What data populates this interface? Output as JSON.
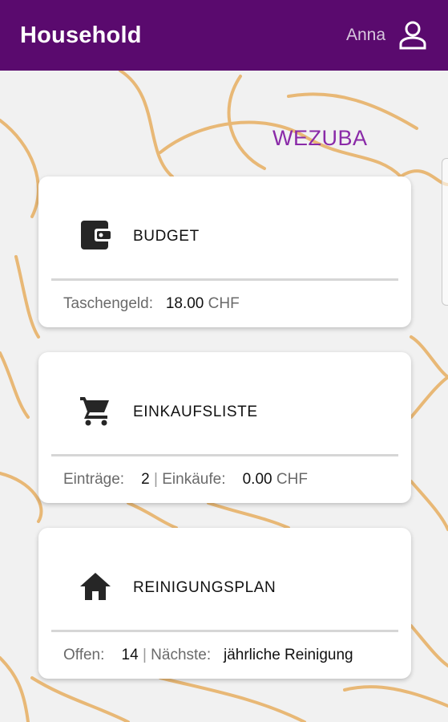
{
  "app_bar": {
    "title": "Household",
    "user_name": "Anna",
    "bg_color": "#5a0a6e"
  },
  "brand": {
    "text": "WEZUBA",
    "color": "#8a2aa8"
  },
  "cards": [
    {
      "icon": "wallet-icon",
      "title": "BUDGET",
      "footer": {
        "label": "Taschengeld:",
        "value": "18.00",
        "unit": "CHF"
      }
    },
    {
      "icon": "cart-icon",
      "title": "EINKAUFSLISTE",
      "footer": {
        "label1": "Einträge:",
        "value1": "2",
        "separator": "|",
        "label2": "Einkäufe:",
        "value2": "0.00",
        "unit": "CHF"
      }
    },
    {
      "icon": "home-icon",
      "title": "REINIGUNGSPLAN",
      "footer": {
        "label1": "Offen:",
        "value1": "14",
        "separator": "|",
        "label2": "Nächste:",
        "value2": "jährliche Reinigung"
      }
    }
  ]
}
